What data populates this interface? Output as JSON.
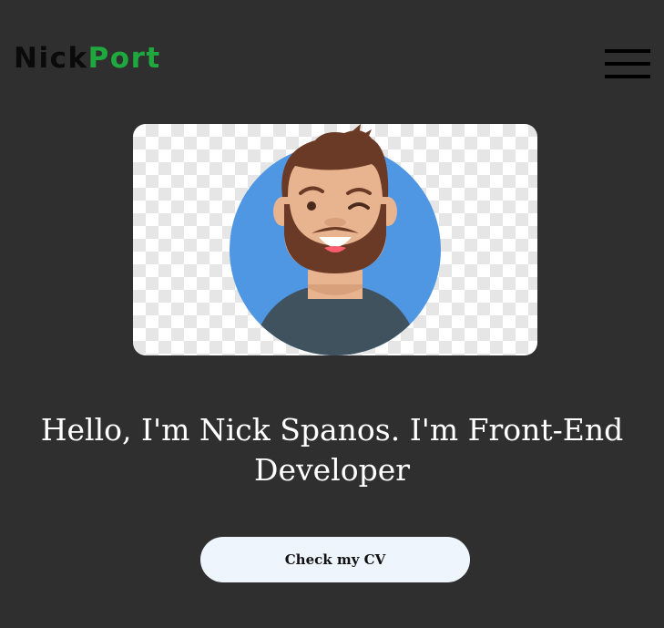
{
  "header": {
    "logo_first": "Nick",
    "logo_second": "Port",
    "menu_icon": "hamburger-menu-icon"
  },
  "hero": {
    "avatar_icon": "avatar-illustration",
    "headline": "Hello, I'm Nick Spanos. I'm Front-End Developer",
    "cta_label": "Check my CV"
  },
  "colors": {
    "background": "#2f2f2f",
    "logo_first": "#0a0a0a",
    "logo_accent": "#1fa83e",
    "button_bg": "#eef5fd",
    "avatar_circle": "#4f96e3",
    "shirt": "#3f525e"
  }
}
